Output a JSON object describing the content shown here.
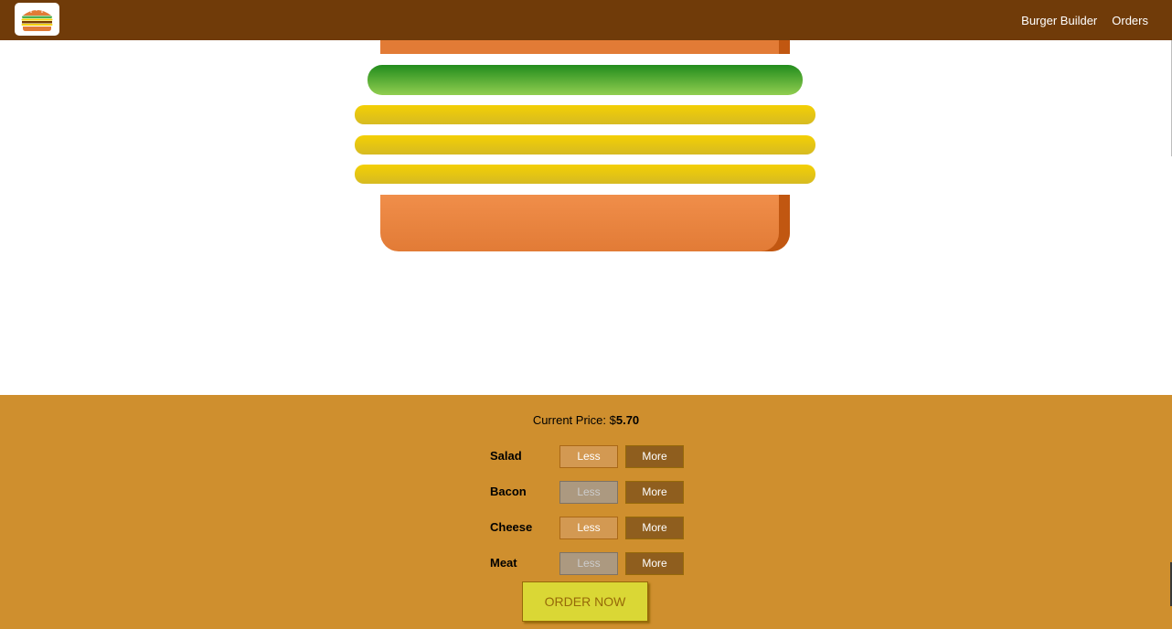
{
  "nav": {
    "items": [
      {
        "label": "Burger Builder"
      },
      {
        "label": "Orders"
      }
    ]
  },
  "build_controls": {
    "price_label": "Current Price: $",
    "price_value": "5.70",
    "controls": [
      {
        "label": "Salad",
        "less": "Less",
        "more": "More",
        "less_disabled": false
      },
      {
        "label": "Bacon",
        "less": "Less",
        "more": "More",
        "less_disabled": true
      },
      {
        "label": "Cheese",
        "less": "Less",
        "more": "More",
        "less_disabled": false
      },
      {
        "label": "Meat",
        "less": "Less",
        "more": "More",
        "less_disabled": true
      }
    ],
    "order_button": "ORDER NOW"
  },
  "colors": {
    "toolbar": "#703b09",
    "controls_bg": "#cf8f2e",
    "bread": "#e27b36",
    "salad": "#228c1d",
    "cheese": "#f4d004",
    "order_button": "#dad735"
  },
  "icons": {
    "logo": "burger-logo-icon"
  }
}
